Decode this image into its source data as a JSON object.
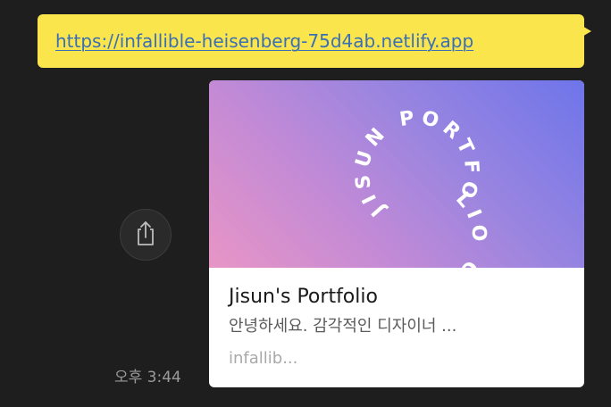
{
  "message": {
    "link_url": "https://infallible-heisenberg-75d4ab.netlify.app",
    "timestamp": "오후 3:44"
  },
  "preview": {
    "image_text": "JISUN PORTFOLIO OF",
    "title": "Jisun's Portfolio",
    "description": "안녕하세요. 감각적인 디자이너 ...",
    "domain": "infallib..."
  },
  "colors": {
    "bubble": "#fbe54d",
    "link": "#3a6fb5",
    "background": "#1e1e1e",
    "gradient_start": "#6e75ea",
    "gradient_end": "#e895c5"
  },
  "icons": {
    "share": "share-icon"
  }
}
